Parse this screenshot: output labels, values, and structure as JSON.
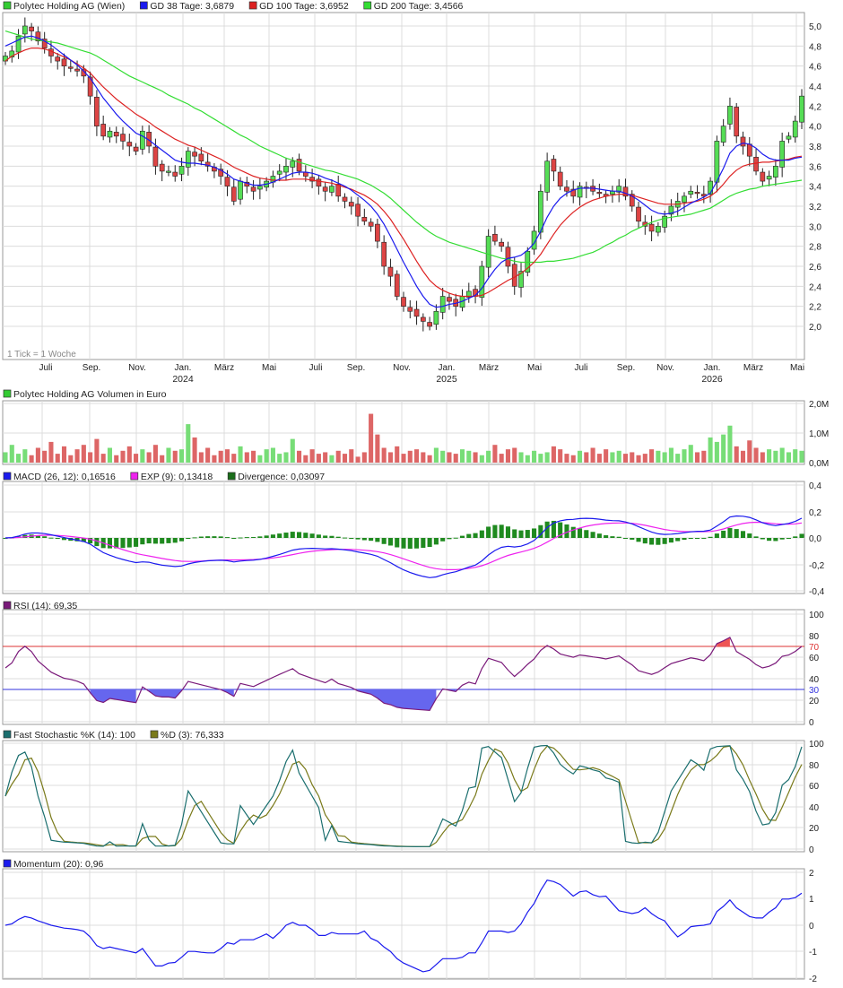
{
  "chart_data": [
    {
      "type": "candlestick",
      "legend": [
        {
          "label": "Polytec Holding AG (Wien)",
          "color": "#33cc33"
        },
        {
          "label": "GD 38 Tage: 3,6879",
          "color": "#1a1aee"
        },
        {
          "label": "GD 100 Tage: 3,6952",
          "color": "#dd2222"
        },
        {
          "label": "GD 200 Tage: 3,4566",
          "color": "#33dd33"
        }
      ],
      "y_ticks": [
        "5,0",
        "4,8",
        "4,6",
        "4,4",
        "4,2",
        "4,0",
        "3,8",
        "3,6",
        "3,4",
        "3,2",
        "3,0",
        "2,8",
        "2,6",
        "2,4",
        "2,2",
        "2,0"
      ],
      "ylim": [
        1.86,
        5.12
      ],
      "note": "1 Tick = 1 Woche",
      "x_ticks": [
        "Juli",
        "Sep.",
        "Nov.",
        "Jan.",
        "März",
        "Mai",
        "Juli",
        "Sep.",
        "Nov.",
        "Jan.",
        "März",
        "Mai",
        "Juli",
        "Sep.",
        "Nov.",
        "Jan.",
        "März",
        "Mai"
      ],
      "year_labels": [
        {
          "tick": 3,
          "label": "2024"
        },
        {
          "tick": 9,
          "label": "2025"
        },
        {
          "tick": 15,
          "label": "2026"
        }
      ],
      "close_weekly": [
        4.7,
        4.75,
        4.9,
        5.0,
        4.95,
        4.85,
        4.78,
        4.7,
        4.65,
        4.6,
        4.58,
        4.55,
        4.5,
        4.3,
        4.0,
        3.9,
        3.95,
        3.9,
        3.85,
        3.8,
        3.75,
        3.95,
        3.8,
        3.6,
        3.55,
        3.55,
        3.5,
        3.6,
        3.75,
        3.7,
        3.65,
        3.6,
        3.55,
        3.5,
        3.4,
        3.25,
        3.45,
        3.4,
        3.35,
        3.4,
        3.45,
        3.5,
        3.55,
        3.6,
        3.65,
        3.55,
        3.5,
        3.45,
        3.4,
        3.35,
        3.4,
        3.3,
        3.25,
        3.2,
        3.1,
        3.05,
        3.0,
        2.85,
        2.6,
        2.5,
        2.3,
        2.2,
        2.15,
        2.1,
        2.05,
        2.0,
        2.15,
        2.3,
        2.25,
        2.2,
        2.3,
        2.35,
        2.3,
        2.6,
        2.9,
        2.85,
        2.8,
        2.6,
        2.4,
        2.55,
        2.75,
        2.95,
        3.35,
        3.65,
        3.55,
        3.4,
        3.35,
        3.3,
        3.4,
        3.38,
        3.35,
        3.33,
        3.3,
        3.35,
        3.4,
        3.3,
        3.2,
        3.05,
        3.0,
        2.95,
        3.0,
        3.1,
        3.2,
        3.25,
        3.3,
        3.35,
        3.33,
        3.3,
        3.45,
        3.85,
        4.0,
        4.2,
        3.9,
        3.8,
        3.7,
        3.55,
        3.45,
        3.5,
        3.6,
        3.85,
        3.9,
        4.05,
        4.3
      ],
      "ma38": [
        4.8,
        4.83,
        4.86,
        4.89,
        4.9,
        4.88,
        4.85,
        4.81,
        4.76,
        4.71,
        4.66,
        4.61,
        4.55,
        4.48,
        4.38,
        4.28,
        4.2,
        4.12,
        4.05,
        3.99,
        3.93,
        3.9,
        3.86,
        3.81,
        3.76,
        3.71,
        3.66,
        3.64,
        3.63,
        3.63,
        3.62,
        3.61,
        3.59,
        3.56,
        3.52,
        3.47,
        3.45,
        3.43,
        3.41,
        3.41,
        3.42,
        3.44,
        3.47,
        3.5,
        3.53,
        3.54,
        3.54,
        3.53,
        3.51,
        3.48,
        3.46,
        3.43,
        3.4,
        3.36,
        3.31,
        3.26,
        3.2,
        3.12,
        3.02,
        2.9,
        2.77,
        2.64,
        2.52,
        2.4,
        2.3,
        2.22,
        2.19,
        2.2,
        2.22,
        2.23,
        2.25,
        2.28,
        2.31,
        2.38,
        2.48,
        2.57,
        2.64,
        2.68,
        2.69,
        2.71,
        2.76,
        2.83,
        2.95,
        3.09,
        3.2,
        3.28,
        3.33,
        3.36,
        3.38,
        3.38,
        3.38,
        3.37,
        3.36,
        3.35,
        3.35,
        3.33,
        3.3,
        3.26,
        3.21,
        3.16,
        3.13,
        3.12,
        3.13,
        3.15,
        3.19,
        3.23,
        3.26,
        3.29,
        3.33,
        3.45,
        3.58,
        3.73,
        3.8,
        3.83,
        3.82,
        3.78,
        3.72,
        3.68,
        3.66,
        3.66,
        3.66,
        3.68,
        3.69
      ],
      "ma100": [
        4.65,
        4.7,
        4.73,
        4.76,
        4.78,
        4.78,
        4.77,
        4.75,
        4.72,
        4.69,
        4.66,
        4.62,
        4.58,
        4.53,
        4.46,
        4.39,
        4.33,
        4.27,
        4.22,
        4.17,
        4.12,
        4.08,
        4.04,
        3.99,
        3.95,
        3.91,
        3.87,
        3.84,
        3.81,
        3.79,
        3.76,
        3.73,
        3.7,
        3.67,
        3.63,
        3.59,
        3.56,
        3.53,
        3.5,
        3.48,
        3.47,
        3.46,
        3.46,
        3.46,
        3.47,
        3.47,
        3.47,
        3.46,
        3.45,
        3.44,
        3.43,
        3.41,
        3.39,
        3.37,
        3.34,
        3.31,
        3.27,
        3.22,
        3.15,
        3.07,
        2.97,
        2.87,
        2.76,
        2.65,
        2.55,
        2.46,
        2.4,
        2.36,
        2.33,
        2.31,
        2.3,
        2.3,
        2.3,
        2.31,
        2.34,
        2.38,
        2.42,
        2.46,
        2.49,
        2.53,
        2.58,
        2.64,
        2.72,
        2.82,
        2.92,
        3.01,
        3.08,
        3.14,
        3.19,
        3.23,
        3.26,
        3.28,
        3.3,
        3.31,
        3.32,
        3.32,
        3.31,
        3.29,
        3.27,
        3.25,
        3.23,
        3.22,
        3.22,
        3.22,
        3.23,
        3.24,
        3.25,
        3.27,
        3.3,
        3.35,
        3.42,
        3.5,
        3.56,
        3.6,
        3.62,
        3.63,
        3.64,
        3.64,
        3.65,
        3.66,
        3.67,
        3.69,
        3.7
      ],
      "ma200": [
        4.95,
        4.93,
        4.91,
        4.89,
        4.87,
        4.86,
        4.85,
        4.84,
        4.83,
        4.81,
        4.79,
        4.77,
        4.75,
        4.73,
        4.7,
        4.66,
        4.62,
        4.58,
        4.54,
        4.5,
        4.47,
        4.44,
        4.41,
        4.38,
        4.35,
        4.31,
        4.28,
        4.25,
        4.22,
        4.18,
        4.15,
        4.11,
        4.07,
        4.03,
        3.99,
        3.95,
        3.91,
        3.88,
        3.84,
        3.8,
        3.77,
        3.74,
        3.71,
        3.68,
        3.66,
        3.64,
        3.62,
        3.6,
        3.58,
        3.56,
        3.55,
        3.53,
        3.51,
        3.49,
        3.47,
        3.44,
        3.41,
        3.37,
        3.33,
        3.28,
        3.22,
        3.16,
        3.1,
        3.04,
        2.99,
        2.94,
        2.9,
        2.87,
        2.84,
        2.82,
        2.8,
        2.78,
        2.76,
        2.74,
        2.72,
        2.7,
        2.68,
        2.67,
        2.65,
        2.64,
        2.64,
        2.64,
        2.64,
        2.65,
        2.65,
        2.66,
        2.67,
        2.68,
        2.7,
        2.72,
        2.74,
        2.77,
        2.81,
        2.84,
        2.88,
        2.91,
        2.95,
        2.98,
        3.01,
        3.04,
        3.06,
        3.08,
        3.09,
        3.1,
        3.11,
        3.12,
        3.14,
        3.16,
        3.18,
        3.22,
        3.26,
        3.3,
        3.33,
        3.35,
        3.37,
        3.38,
        3.4,
        3.41,
        3.42,
        3.43,
        3.44,
        3.45,
        3.46
      ]
    },
    {
      "type": "bar",
      "legend": [
        {
          "label": "Polytec Holding AG Volumen in Euro",
          "color": "#33cc33"
        }
      ],
      "y_ticks": [
        "2,0M",
        "1,0M",
        "0,0M"
      ],
      "ylim": [
        0,
        2.05
      ],
      "values_m": [
        0.35,
        0.6,
        0.3,
        0.45,
        0.25,
        0.5,
        0.4,
        0.7,
        0.3,
        0.55,
        0.25,
        0.45,
        0.6,
        0.35,
        0.8,
        0.3,
        0.5,
        0.25,
        0.4,
        0.55,
        0.3,
        0.45,
        0.35,
        0.6,
        0.25,
        0.5,
        0.4,
        0.45,
        1.3,
        0.85,
        0.35,
        0.5,
        0.25,
        0.4,
        0.45,
        0.3,
        0.55,
        0.35,
        0.4,
        0.25,
        0.45,
        0.5,
        0.3,
        0.35,
        0.8,
        0.4,
        0.25,
        0.45,
        0.3,
        0.35,
        0.25,
        0.4,
        0.3,
        0.45,
        0.2,
        0.35,
        1.65,
        0.95,
        0.5,
        0.35,
        0.55,
        0.3,
        0.4,
        0.45,
        0.35,
        0.25,
        0.5,
        0.4,
        0.35,
        0.3,
        0.45,
        0.4,
        0.35,
        0.25,
        0.4,
        0.6,
        0.3,
        0.45,
        0.5,
        0.35,
        0.25,
        0.4,
        0.3,
        0.35,
        0.55,
        0.45,
        0.3,
        0.25,
        0.4,
        0.35,
        0.5,
        0.3,
        0.45,
        0.35,
        0.4,
        0.3,
        0.35,
        0.25,
        0.3,
        0.45,
        0.4,
        0.35,
        0.5,
        0.3,
        0.45,
        0.6,
        0.35,
        0.4,
        0.85,
        0.7,
        0.95,
        1.25,
        0.55,
        0.4,
        0.75,
        0.5,
        0.35,
        0.45,
        0.4,
        0.5,
        0.35,
        0.45,
        0.4
      ]
    },
    {
      "type": "line",
      "legend": [
        {
          "label": "MACD (26, 12): 0,16516",
          "color": "#1a1aee"
        },
        {
          "label": "EXP (9): 0,13418",
          "color": "#ee22ee"
        },
        {
          "label": "Divergence: 0,03097",
          "color": "#1a6e1a"
        }
      ],
      "y_ticks": [
        "0,4",
        "0,2",
        "0,0",
        "-0,2",
        "-0,4"
      ],
      "ylim": [
        -0.41,
        0.42
      ]
    },
    {
      "type": "line",
      "legend": [
        {
          "label": "RSI (14): 69,35",
          "color": "#7a1a7a"
        }
      ],
      "y_ticks": [
        "100",
        "80",
        "60",
        "40",
        "20",
        "0"
      ],
      "level_labels": [
        "70",
        "30"
      ],
      "ylim": [
        0,
        100
      ]
    },
    {
      "type": "line",
      "legend": [
        {
          "label": "Fast Stochastic %K (14): 100",
          "color": "#1a6e6e"
        },
        {
          "label": "%D (3): 76,333",
          "color": "#7a7a1a"
        }
      ],
      "y_ticks": [
        "100",
        "80",
        "60",
        "40",
        "20",
        "0"
      ],
      "ylim": [
        0,
        100
      ]
    },
    {
      "type": "line",
      "legend": [
        {
          "label": "Momentum (20): 0,96",
          "color": "#1a1aee"
        }
      ],
      "y_ticks": [
        "2",
        "1",
        "0",
        "-1",
        "-2"
      ],
      "ylim": [
        -2,
        2
      ]
    }
  ]
}
